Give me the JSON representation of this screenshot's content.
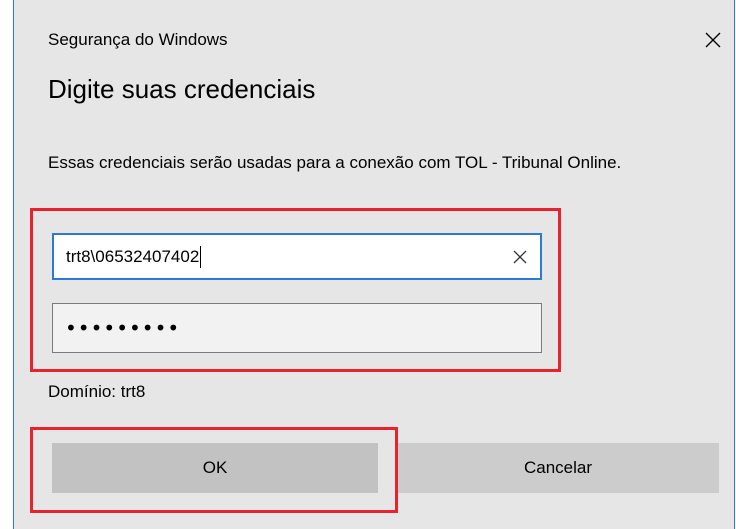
{
  "window": {
    "app_title": "Segurança do Windows",
    "close_icon": "close-icon"
  },
  "heading": "Digite suas credenciais",
  "description": "Essas credenciais serão usadas para a conexão com TOL - Tribunal Online.",
  "username": {
    "value": "trt8\\06532407402",
    "clear_icon": "clear-icon"
  },
  "password": {
    "masked_value": "•••••••••"
  },
  "domain_label": "Domínio: trt8",
  "buttons": {
    "ok": "OK",
    "cancel": "Cancelar"
  },
  "colors": {
    "dialog_bg": "#e6e6e6",
    "accent_border": "#2b7bd6",
    "highlight": "#e8232e"
  }
}
